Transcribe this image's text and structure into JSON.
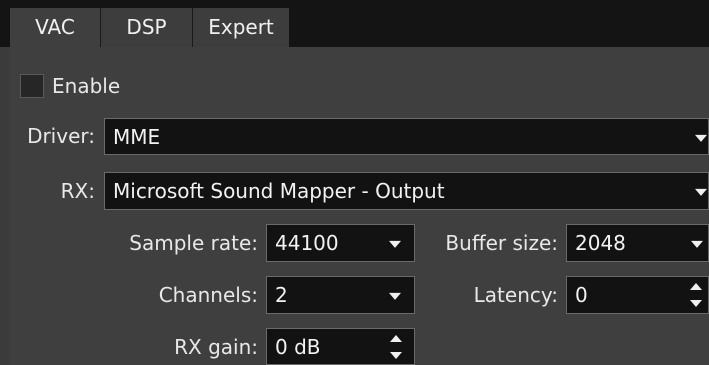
{
  "tabs": [
    {
      "label": "VAC",
      "active": true
    },
    {
      "label": "DSP",
      "active": false
    },
    {
      "label": "Expert",
      "active": false
    }
  ],
  "enable": {
    "label": "Enable",
    "checked": false
  },
  "driver": {
    "label": "Driver:",
    "value": "MME",
    "icon": "chevron-down-icon"
  },
  "rx": {
    "label": "RX:",
    "value": "Microsoft Sound Mapper - Output",
    "icon": "chevron-down-icon"
  },
  "sample_rate": {
    "label": "Sample rate:",
    "value": "44100"
  },
  "buffer_size": {
    "label": "Buffer size:",
    "value": "2048"
  },
  "channels": {
    "label": "Channels:",
    "value": "2"
  },
  "latency": {
    "label": "Latency:",
    "value": "0"
  },
  "rx_gain": {
    "label": "RX gain:",
    "value": "0 dB"
  },
  "colors": {
    "background": "#3f3f3f",
    "field": "#121212",
    "tabbar_fill": "#141414",
    "text": "#e8e8e8"
  }
}
